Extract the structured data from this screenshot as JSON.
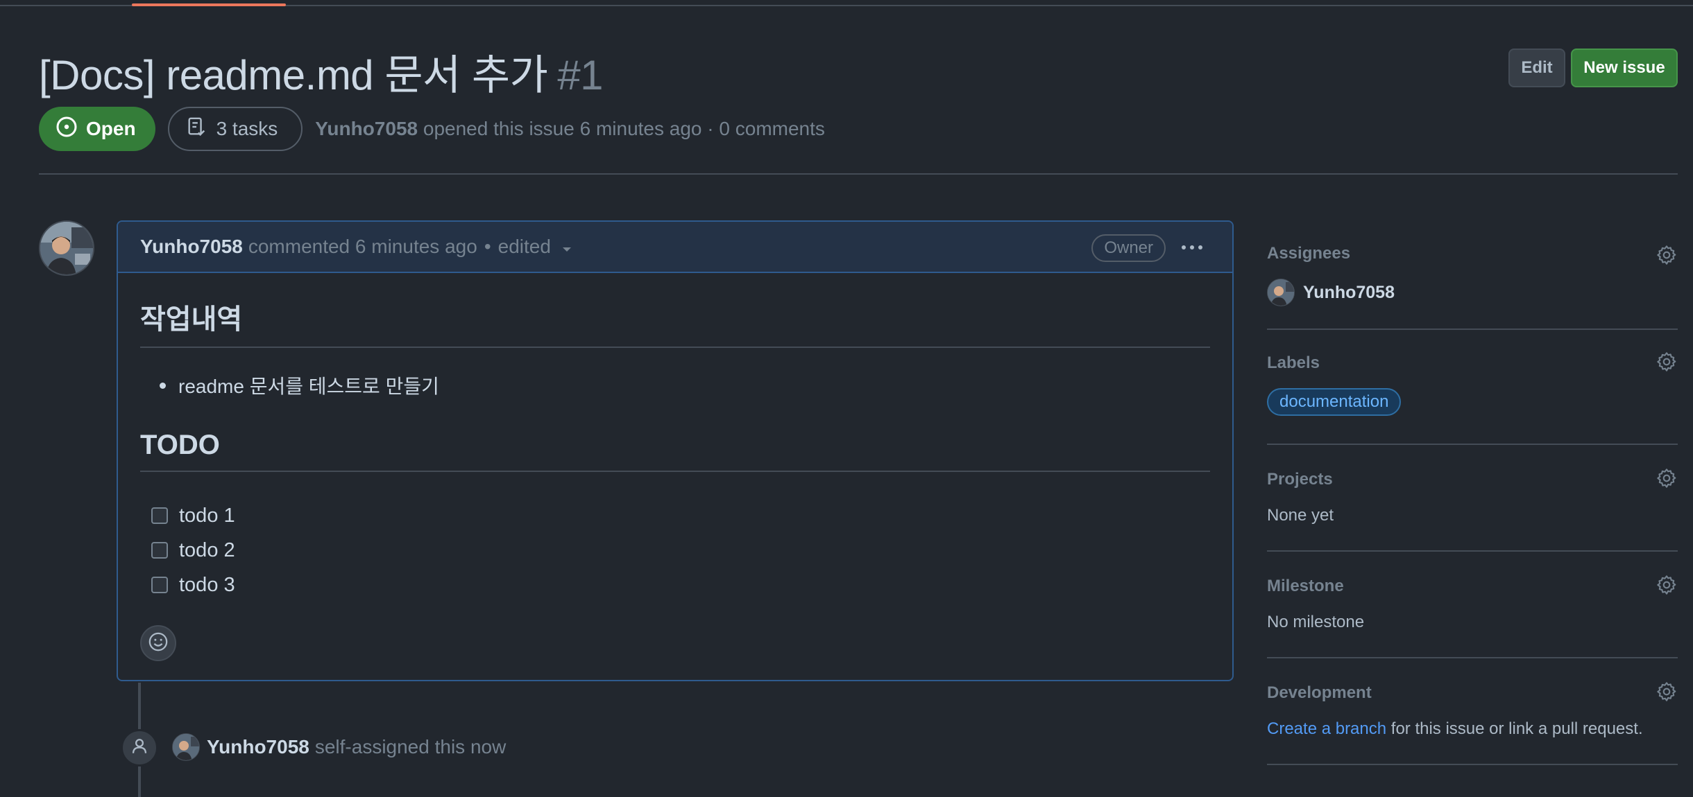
{
  "issue": {
    "title": "[Docs] readme.md 문서 추가",
    "number": "#1",
    "state": "Open",
    "tasks": "3 tasks",
    "author": "Yunho7058",
    "meta_action": "opened this issue",
    "meta_time": "6 minutes ago",
    "meta_sep": "·",
    "meta_comments": "0 comments"
  },
  "header_buttons": {
    "edit_label": "Edit",
    "new_issue_label": "New issue"
  },
  "comment": {
    "author": "Yunho7058",
    "action": "commented 6 minutes ago",
    "sep": "•",
    "edited": "edited",
    "badge": "Owner",
    "heading1": "작업내역",
    "bullets": [
      "readme 문서를 테스트로 만들기"
    ],
    "heading2": "TODO",
    "tasks": [
      "todo 1",
      "todo 2",
      "todo 3"
    ]
  },
  "event": {
    "author": "Yunho7058",
    "text": "self-assigned this now"
  },
  "sidebar": {
    "assignees": {
      "title": "Assignees",
      "value": "Yunho7058"
    },
    "labels": {
      "title": "Labels",
      "value": "documentation"
    },
    "projects": {
      "title": "Projects",
      "value": "None yet"
    },
    "milestone": {
      "title": "Milestone",
      "value": "No milestone"
    },
    "development": {
      "title": "Development",
      "link": "Create a branch",
      "rest": " for this issue or link a pull request."
    }
  },
  "colors": {
    "background": "#22272e",
    "open_green": "#347d39",
    "link_blue": "#539bf5",
    "label_blue": "#6cb6ff",
    "tab_accent": "#ec775c"
  },
  "icons": [
    "issue-opened-icon",
    "tasklist-icon",
    "kebab-icon",
    "triangle-down-icon",
    "smiley-icon",
    "person-icon",
    "gear-icon"
  ]
}
